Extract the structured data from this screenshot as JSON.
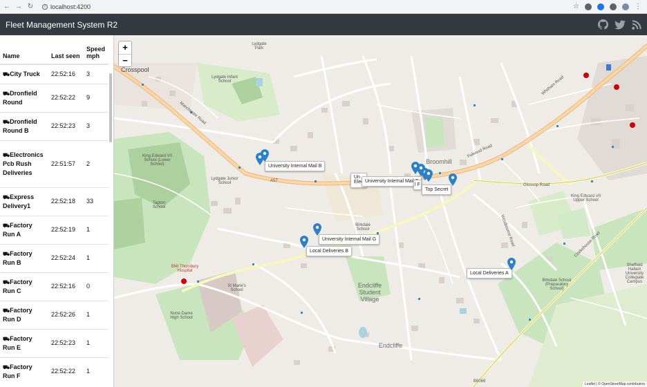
{
  "browser": {
    "url": "localhost:4200"
  },
  "navbar": {
    "title": "Fleet Management System R2",
    "icons": [
      "github-icon",
      "twitter-icon",
      "rss-icon"
    ]
  },
  "table": {
    "headers": [
      "Name",
      "Last seen",
      "Speed mph"
    ],
    "rows": [
      {
        "name": "City Truck",
        "time": "22:52:16",
        "speed": "3"
      },
      {
        "name": "Dronfield Round",
        "time": "22:52:22",
        "speed": "9"
      },
      {
        "name": "Dronfield Round B",
        "time": "22:52:23",
        "speed": "3"
      },
      {
        "name": "Electronics Pcb Rush Deliveries",
        "time": "22:51:57",
        "speed": "2"
      },
      {
        "name": "Express Delivery1",
        "time": "22:52:18",
        "speed": "33"
      },
      {
        "name": "Factory Run A",
        "time": "22:52:19",
        "speed": "1"
      },
      {
        "name": "Factory Run B",
        "time": "22:52:24",
        "speed": "1"
      },
      {
        "name": "Factory Run C",
        "time": "22:52:16",
        "speed": "0"
      },
      {
        "name": "Factory Run D",
        "time": "22:52:26",
        "speed": "1"
      },
      {
        "name": "Factory Run E",
        "time": "22:52:23",
        "speed": "1"
      },
      {
        "name": "Factory Run F",
        "time": "22:52:22",
        "speed": "1"
      }
    ]
  },
  "map": {
    "zoom_in": "+",
    "zoom_out": "−",
    "vehicle_labels": {
      "univ_b": "University Internal Mail B",
      "univ_e": "University Internal Mail E",
      "univ_g": "University Internal Mail G",
      "univ_partial": "Un",
      "elec_partial": "Elec",
      "local_b": "Local Deliveries B",
      "local_a": "Local Deliveries A",
      "top_secret": "Top Secret",
      "partial_f": "l F"
    },
    "place_labels": {
      "crosspool": "Crosspool",
      "broomhill": "Broomhill",
      "endcliffe": "Endcliffe",
      "endcliffe_village": "Endcliffe Student Village",
      "ludgate": "Lydgate Park",
      "lydgate_infant": "Lydgate Infant School",
      "lydgate_junior": "Lydgate Junior School",
      "tapton": "Tapton School",
      "king_edward": "King Edward VII School (Lower School)",
      "bmi": "BMI Thornbury Hospital",
      "st_marys": "St Marie's School",
      "notre_dame": "Notre Dame High School",
      "birkdale": "Birkdale School",
      "birkdale_prep": "Birkdale School (Preparatory School)",
      "sheffield_hallam": "Sheffield Hallam University Collegiate Campus",
      "king_edward_upper": "King Edward VII Upper School",
      "manchester_road": "Manchester Road",
      "a57": "A57",
      "fulwood_road": "Fulwood Road",
      "glossop_road": "Glossop Road",
      "whitham_road": "Whitham Road",
      "clarkehouse_road": "Clarkehouse Road",
      "westbourne_road": "Westbourne Road",
      "b6069": "B6069"
    },
    "attribution": "Leaflet | © OpenStreetMap contributors"
  }
}
